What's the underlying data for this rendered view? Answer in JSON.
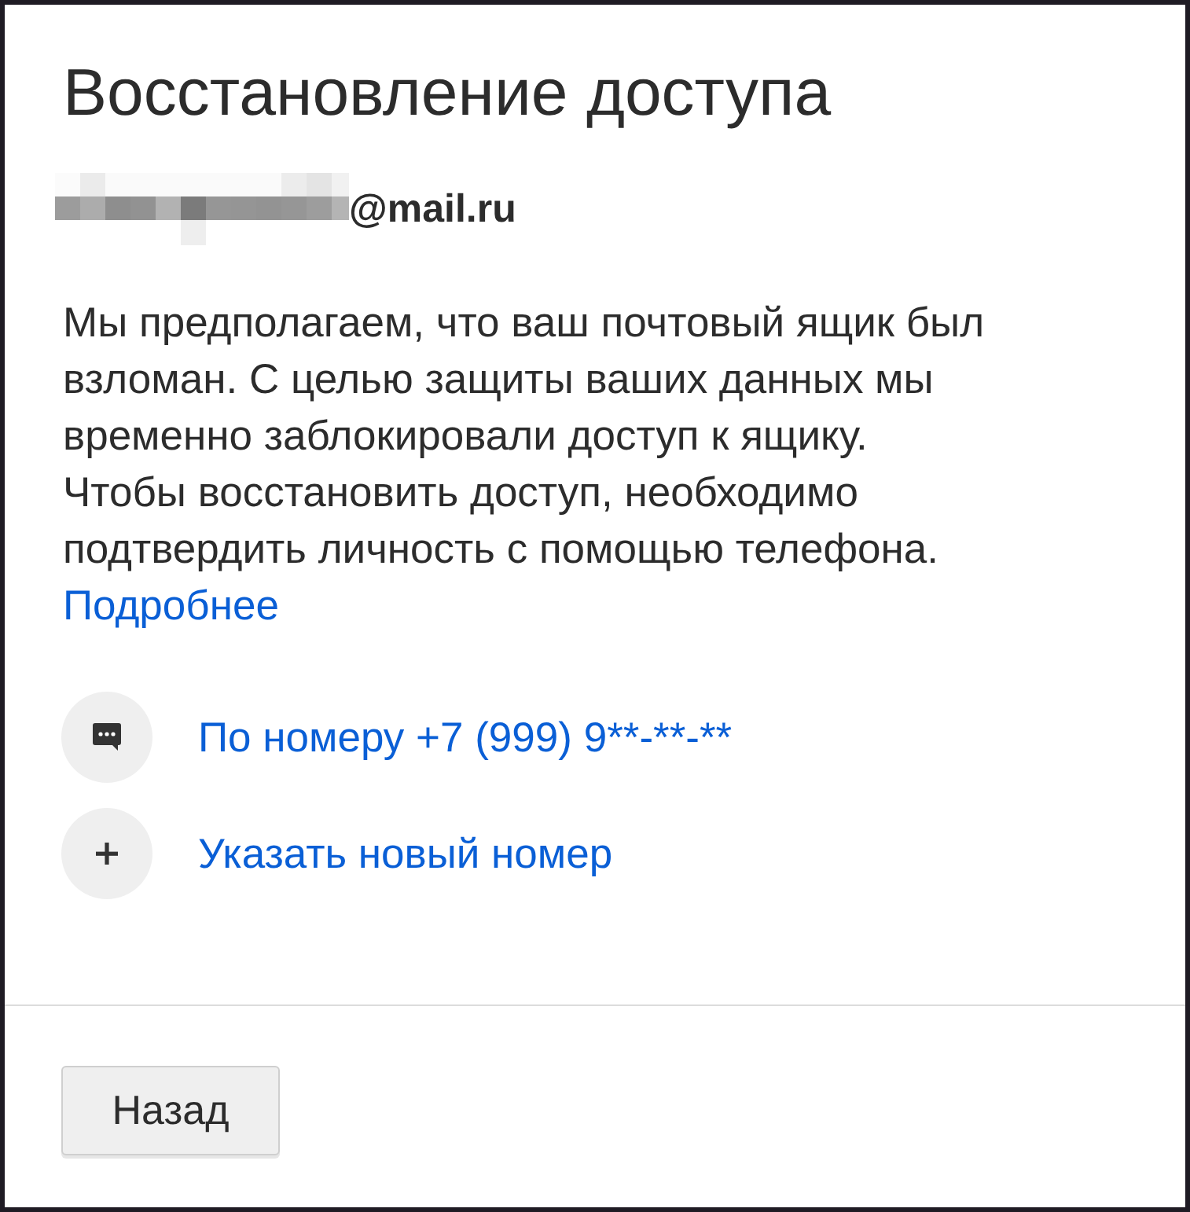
{
  "title": "Восстановление доступа",
  "account": {
    "redacted": true,
    "email_domain": "@mail.ru"
  },
  "message": "Мы предполагаем, что ваш почтовый ящик был взломан. С целью защиты ваших данных мы временно заблокировали доступ к ящику. Чтобы восстановить доступ, необходимо подтвердить личность с помощью телефона.",
  "more_link": "Подробнее",
  "options": [
    {
      "kind": "sms",
      "label": "По номеру +7 (999) 9**-**-**"
    },
    {
      "kind": "add",
      "label": "Указать новый номер"
    }
  ],
  "footer": {
    "back_button": "Назад"
  }
}
